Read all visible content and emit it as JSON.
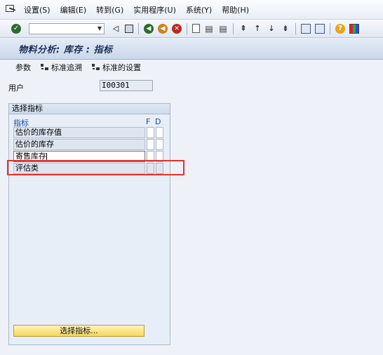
{
  "menu": {
    "items": [
      "设置(S)",
      "编辑(E)",
      "转到(G)",
      "实用程序(U)",
      "系统(Y)",
      "帮助(H)"
    ]
  },
  "toolbar": {
    "command_field_value": "",
    "icons": [
      "enter-check",
      "back",
      "save",
      "back-green",
      "exit",
      "cancel",
      "print",
      "find",
      "find-next",
      "first-page",
      "previous-page",
      "next-page",
      "last-page",
      "new-session",
      "shortcut",
      "help",
      "customize-layout"
    ]
  },
  "title": "物料分析: 库存 : 指标",
  "app_toolbar": {
    "params_label": "参数",
    "standard_drilldown_label": "标准追溯",
    "standard_settings_label": "标准的设置"
  },
  "user": {
    "label": "用户",
    "value": "I00301"
  },
  "indicators": {
    "group_title": "选择指标",
    "col_name": "指标",
    "col_f": "F",
    "col_d": "D",
    "rows": [
      {
        "name": "估价的库存值"
      },
      {
        "name": "估价的库存"
      },
      {
        "name": "寄售库存"
      },
      {
        "name": "评估类"
      }
    ],
    "select_button": "选择指标..."
  },
  "colors": {
    "highlight": "#e0342d",
    "button_yellow": "#f4d75a",
    "title_text": "#1b2f55",
    "header_blue": "#1b46a8"
  }
}
